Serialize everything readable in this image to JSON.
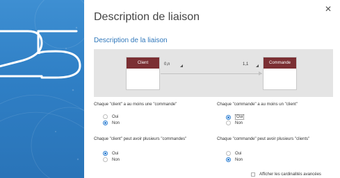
{
  "dialog": {
    "title": "Description de liaison",
    "subtitle": "Description de la liaison",
    "close_icon": "close-icon",
    "accent_color": "#2f77bb",
    "entity_header_color": "#7b2f33"
  },
  "diagram": {
    "left_entity": "Client",
    "right_entity": "Commande",
    "left_cardinality": "0,n",
    "right_cardinality": "1,1"
  },
  "questions": {
    "q1": {
      "text": "Chaque \"client\" a au moins une \"commande\"",
      "options": [
        "Oui",
        "Non"
      ],
      "selected": "Non"
    },
    "q2": {
      "text": "Chaque \"commande\" a au moins un \"client\"",
      "options": [
        "Oui",
        "Non"
      ],
      "selected": "Oui"
    },
    "q3": {
      "text": "Chaque \"client\" peut avoir plusieurs \"commandes\"",
      "options": [
        "Oui",
        "Non"
      ],
      "selected": "Oui"
    },
    "q4": {
      "text": "Chaque \"commande\" peut avoir plusieurs \"clients\"",
      "options": [
        "Oui",
        "Non"
      ],
      "selected": "Non"
    }
  },
  "advanced_checkbox": {
    "label": "Afficher les cardinalités avancées",
    "checked": false
  }
}
